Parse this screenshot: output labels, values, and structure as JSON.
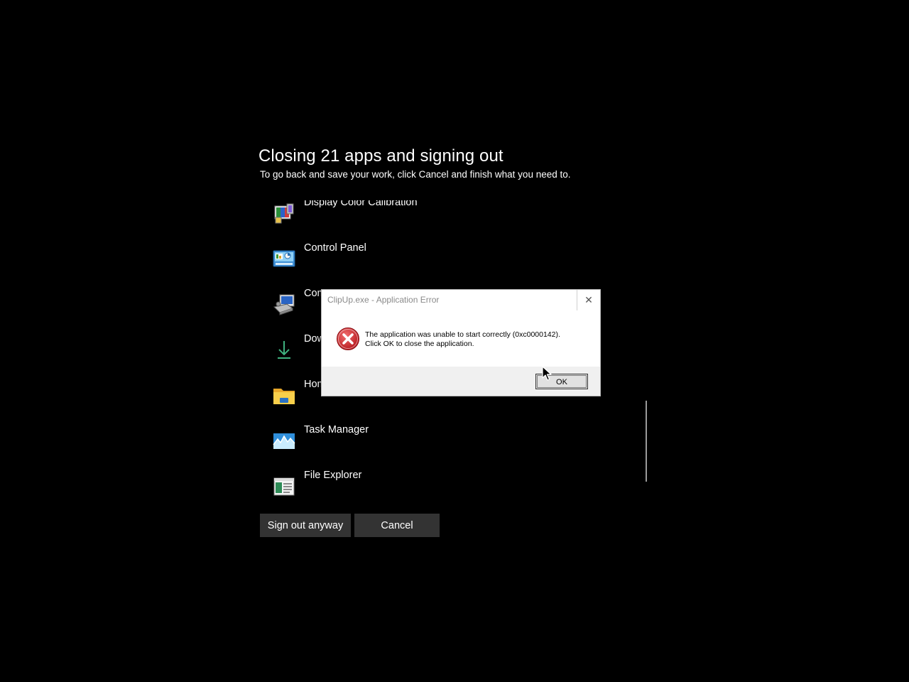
{
  "header": {
    "title": "Closing 21 apps and signing out",
    "subtitle": "To go back and save your work, click Cancel and finish what you need to."
  },
  "apps": [
    {
      "label": "Display Color Calibration",
      "icon": "display-color-calibration-icon"
    },
    {
      "label": "Control Panel",
      "icon": "control-panel-icon"
    },
    {
      "label": "Com",
      "icon": "computer-management-icon"
    },
    {
      "label": "Dow",
      "icon": "download-icon"
    },
    {
      "label": "Hom",
      "icon": "folder-icon"
    },
    {
      "label": "Task Manager",
      "icon": "task-manager-icon"
    },
    {
      "label": "File Explorer",
      "icon": "file-explorer-icon"
    }
  ],
  "buttons": {
    "sign_out": "Sign out anyway",
    "cancel": "Cancel"
  },
  "dialog": {
    "title": "ClipUp.exe - Application Error",
    "close": "✕",
    "message_line1": "The application was unable to start correctly (0xc0000142).",
    "message_line2": "Click OK to close the application.",
    "ok_label": "OK",
    "icon": "error-icon"
  }
}
